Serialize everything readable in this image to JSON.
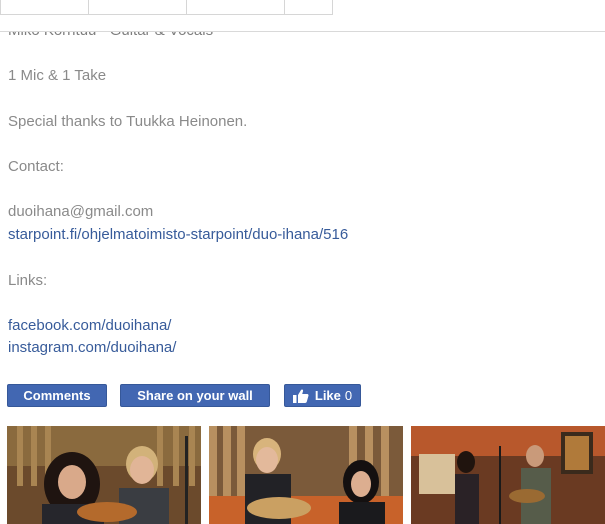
{
  "post": {
    "cutoff_line": "Miko Korhtuu - Guitar & Vocals",
    "line_mic": "1 Mic & 1 Take",
    "thanks": "Special thanks to Tuukka Heinonen.",
    "contact_label": "Contact:",
    "email": "duoihana@gmail.com",
    "starpoint_link": "starpoint.fi/ohjelmatoimisto-starpoint/duo-ihana/516",
    "links_label": "Links:",
    "facebook_link": "facebook.com/duoihana/",
    "instagram_link": "instagram.com/duoihana/"
  },
  "actions": {
    "comments_label": "Comments",
    "share_label": "Share on your wall",
    "like_label": "Like",
    "like_count": "0"
  },
  "icons": {
    "like": "thumbs-up-icon"
  },
  "colors": {
    "button_bg": "#4267b2",
    "link": "#375b9a",
    "muted_text": "#8a8a8a"
  }
}
